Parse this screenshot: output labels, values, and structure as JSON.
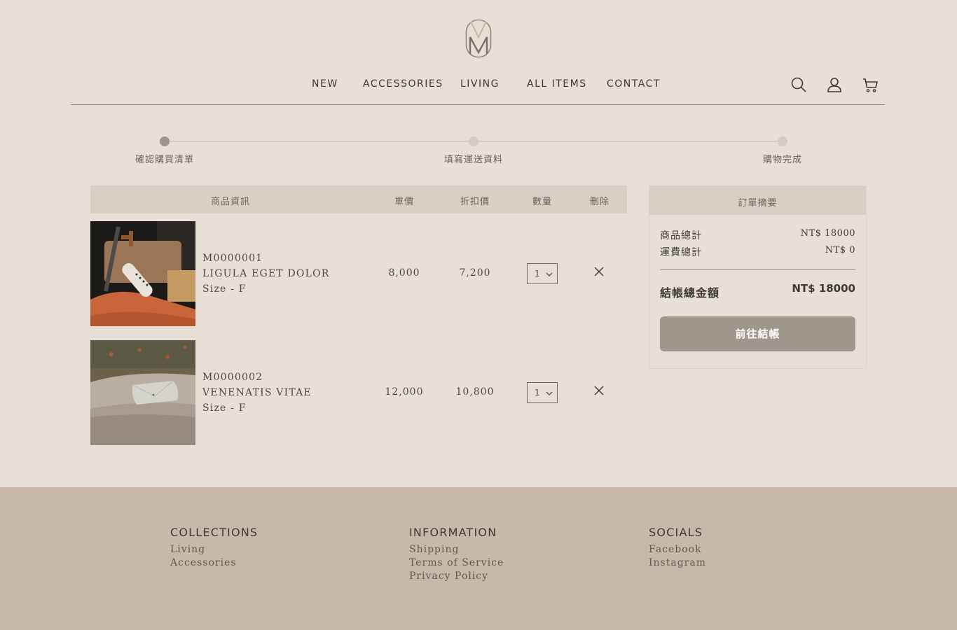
{
  "nav": {
    "items": [
      "NEW",
      "ACCESSORIES",
      "LIVING",
      "ALL ITEMS",
      "CONTACT"
    ]
  },
  "header_icons": [
    "search-icon",
    "user-icon",
    "cart-icon"
  ],
  "steps": [
    {
      "label": "確認購買清單",
      "active": true
    },
    {
      "label": "填寫運送資料",
      "active": false
    },
    {
      "label": "購物完成",
      "active": false
    }
  ],
  "cart": {
    "headers": {
      "info": "商品資訊",
      "price": "單價",
      "discount": "折扣價",
      "qty": "數量",
      "delete": "刪除"
    },
    "items": [
      {
        "sku": "M0000001",
        "name": "LIGULA EGET DOLOR",
        "size": "Size - F",
        "price": "8,000",
        "discount": "7,200",
        "qty": "1"
      },
      {
        "sku": "M0000002",
        "name": "VENENATIS VITAE",
        "size": "Size - F",
        "price": "12,000",
        "discount": "10,800",
        "qty": "1"
      }
    ]
  },
  "summary": {
    "title": "訂單摘要",
    "subtotal_label": "商品總計",
    "subtotal_value": "NT$ 18000",
    "shipping_label": "運費總計",
    "shipping_value": "NT$ 0",
    "total_label": "結帳總金額",
    "total_value": "NT$ 18000",
    "checkout_label": "前往結帳"
  },
  "footer": {
    "collections": {
      "title": "COLLECTIONS",
      "links": [
        "Living",
        "Accessories"
      ]
    },
    "information": {
      "title": "INFORMATION",
      "links": [
        "Shipping",
        "Terms of Service",
        "Privacy Policy"
      ]
    },
    "socials": {
      "title": "SOCIALS",
      "links": [
        "Facebook",
        "Instagram"
      ]
    }
  },
  "colors": {
    "background": "#e8e0d6",
    "table_header": "#d9d0c5",
    "button": "#9f968c",
    "footer": "#c8b8a9",
    "step_active": "#9f968c",
    "step_inactive": "#d6cdc2"
  }
}
